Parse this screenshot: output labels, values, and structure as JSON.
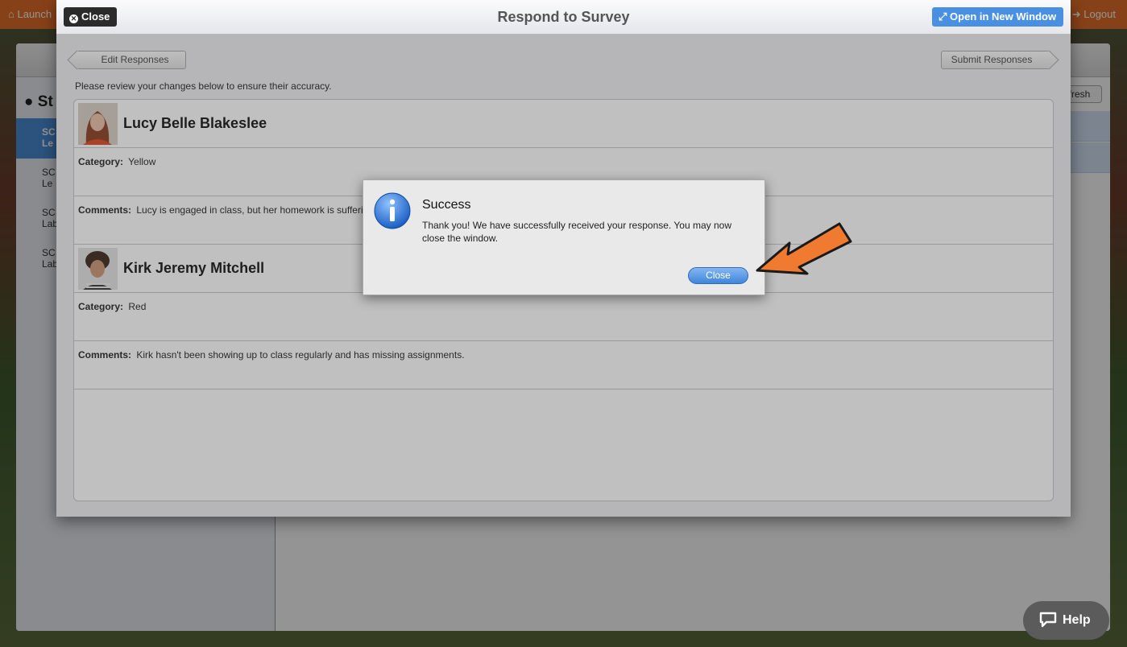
{
  "topbar": {
    "launch_label": "Launch",
    "logout_label": "Logout"
  },
  "background_app": {
    "sidebar_title": "St",
    "sidebar_items": [
      {
        "line1": "SC",
        "line2": "Le",
        "active": true
      },
      {
        "line1": "SC",
        "line2": "Le",
        "active": false
      },
      {
        "line1": "SC",
        "line2": "Lab",
        "active": false
      },
      {
        "line1": "SC",
        "line2": "Lab",
        "active": false
      }
    ],
    "refresh_label": "fresh"
  },
  "survey_modal": {
    "close_label": "Close",
    "title": "Respond to Survey",
    "open_new_window_label": "Open in New Window",
    "edit_responses_label": "Edit Responses",
    "submit_responses_label": "Submit Responses",
    "instructions": "Please review your changes below to ensure their accuracy.",
    "category_label": "Category:",
    "comments_label": "Comments:",
    "students": [
      {
        "name": "Lucy Belle Blakeslee",
        "category": "Yellow",
        "comments": "Lucy is engaged in class, but her homework is sufferi"
      },
      {
        "name": "Kirk Jeremy Mitchell",
        "category": "Red",
        "comments": "Kirk hasn't been showing up to class regularly and has missing assignments."
      }
    ]
  },
  "dialog": {
    "icon": "info-icon",
    "title": "Success",
    "message": "Thank you! We have successfully received your response. You may now close the window.",
    "close_label": "Close"
  },
  "help": {
    "label": "Help",
    "icon": "chat-bubble-icon"
  },
  "colors": {
    "topbar": "#e8702a",
    "accent_blue": "#4a90e2",
    "arrow": "#f07a30"
  }
}
